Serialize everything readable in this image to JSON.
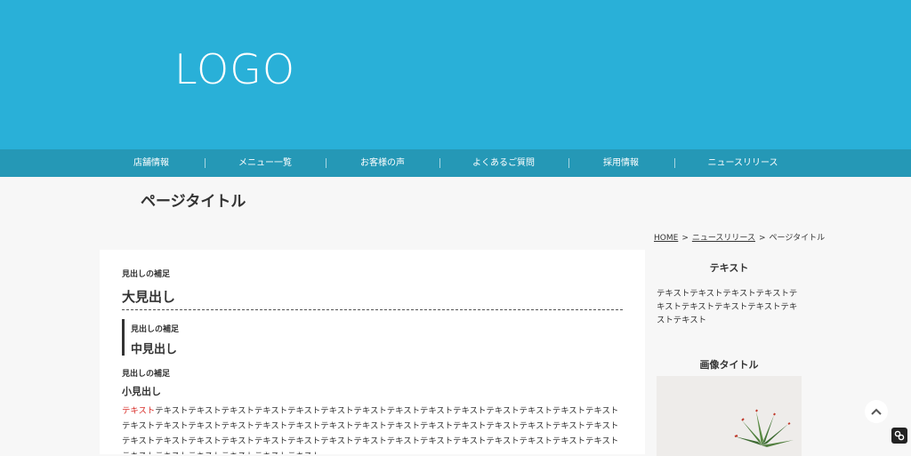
{
  "header": {
    "logo": "LOGO",
    "bg_color": "#29b0d8"
  },
  "nav": {
    "bg_color": "#2598b6",
    "items": [
      "店舗情報",
      "メニュー一覧",
      "お客様の声",
      "よくあるご質問",
      "採用情報",
      "ニュースリリース"
    ]
  },
  "page": {
    "title": "ページタイトル",
    "breadcrumb": {
      "home": "HOME",
      "parent": "ニュースリリース",
      "current": "ページタイトル",
      "separator": ">"
    }
  },
  "main": {
    "large": {
      "sub": "見出しの補足",
      "heading": "大見出し"
    },
    "mid": {
      "sub": "見出しの補足",
      "heading": "中見出し"
    },
    "small": {
      "sub": "見出しの補足",
      "heading": "小見出し"
    },
    "body_highlight": "テキスト",
    "body_text": "テキストテキストテキストテキストテキストテキストテキストテキストテキストテキストテキストテキストテキストテキストテキストテキストテキストテキストテキストテキストテキストテキストテキストテキストテキストテキストテキストテキストテキストテキストテキストテキストテキストテキストテキストテキストテキストテキストテキストテキストテキストテキストテキストテキストテキストテキストテキストテキストテキストテキスト",
    "highlight_color": "#d9302b"
  },
  "sidebar": {
    "text_heading": "テキスト",
    "text_body": "テキストテキストテキストテキストテキストテキストテキストテキストテキストテキスト",
    "image_heading": "画像タイトル"
  },
  "icons": {
    "scroll_top": "chevron-up-icon",
    "corner": "link-icon"
  }
}
